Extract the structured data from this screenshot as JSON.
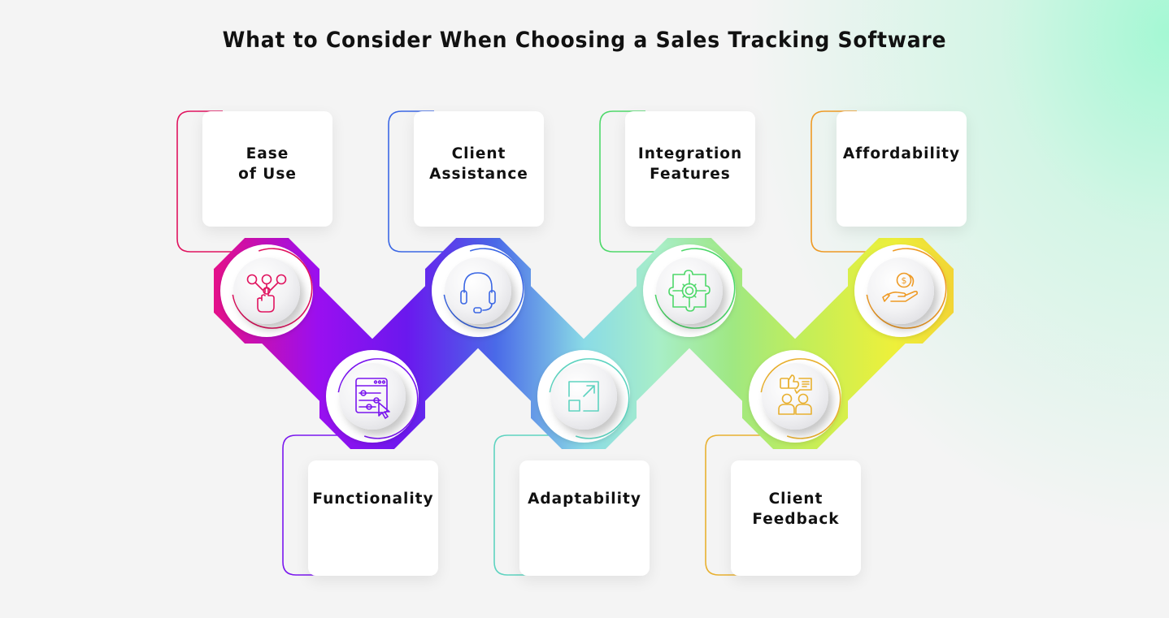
{
  "title": "What to Consider When Choosing a Sales Tracking Software",
  "colors": {
    "background": "#f4f4f4",
    "glow": "#a8f7d3",
    "text": "#111111"
  },
  "factors": [
    {
      "id": "ease-of-use",
      "label": "Ease\nof Use",
      "position": "top",
      "icon": "hand-tap-network-icon",
      "accent": "#e0135f",
      "fill_start": "#e4108a",
      "fill_end": "#9a0ff0"
    },
    {
      "id": "functionality",
      "label": "Functionality",
      "position": "bottom",
      "icon": "settings-window-cursor-icon",
      "accent": "#7a16ee",
      "fill_start": "#a010f0",
      "fill_end": "#6a18ee"
    },
    {
      "id": "client-assistance",
      "label": "Client\nAssistance",
      "position": "top",
      "icon": "headset-icon",
      "accent": "#3b67e4",
      "fill_start": "#5b3ff0",
      "fill_end": "#5aa6e6"
    },
    {
      "id": "adaptability",
      "label": "Adaptability",
      "position": "bottom",
      "icon": "expand-arrow-icon",
      "accent": "#5ed3c0",
      "fill_start": "#68b6ea",
      "fill_end": "#9ff0d0"
    },
    {
      "id": "integration-features",
      "label": "Integration\nFeatures",
      "position": "top",
      "icon": "puzzle-gear-icon",
      "accent": "#4ed86a",
      "fill_start": "#a8eec8",
      "fill_end": "#b9ec5e"
    },
    {
      "id": "client-feedback",
      "label": "Client\nFeedback",
      "position": "bottom",
      "icon": "thumbs-up-people-icon",
      "accent": "#e8b030",
      "fill_start": "#c8ee58",
      "fill_end": "#eef04a"
    },
    {
      "id": "affordability",
      "label": "Affordability",
      "position": "top",
      "icon": "hand-coins-icon",
      "accent": "#ee9a25",
      "fill_start": "#eeee30",
      "fill_end": "#f2d435"
    }
  ]
}
